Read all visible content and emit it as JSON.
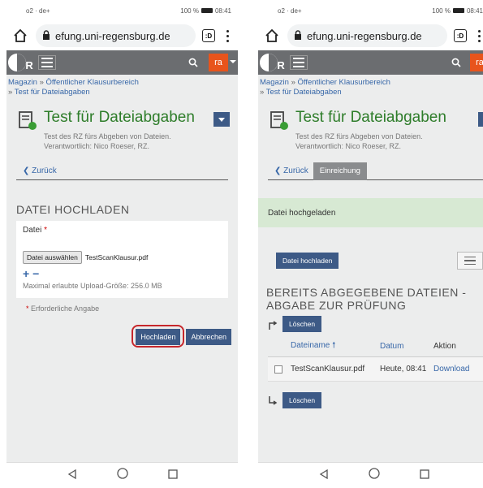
{
  "status_bar": {
    "left": "o2 · de+",
    "right_text": "100 %",
    "time": "08:41"
  },
  "browser": {
    "url": "efung.uni-regensburg.de",
    "tab_count": ":D"
  },
  "site_header": {
    "logo": "UR",
    "user_initials": "ra"
  },
  "breadcrumb": {
    "item1": "Magazin",
    "item2": "Öffentlicher Klausurbereich",
    "item3": "Test für Dateiabgaben",
    "separator": "»"
  },
  "page": {
    "title": "Test für Dateiabgaben",
    "subtitle1": "Test des RZ fürs Abgeben von Dateien.",
    "subtitle2": "Verantwortlich: Nico Roeser, RZ.",
    "back_label": "Zurück",
    "tab_submission": "Einreichung"
  },
  "left_screen": {
    "section_title": "DATEI HOCHLADEN",
    "file_label": "Datei",
    "required_mark": "*",
    "choose_button": "Datei auswählen",
    "chosen_file": "TestScanKlausur.pdf",
    "plus": "+",
    "minus": "−",
    "max_size": "Maximal erlaubte Upload-Größe: 256.0 MB",
    "required_note": "Erforderliche Angabe",
    "upload_button": "Hochladen",
    "cancel_button": "Abbrechen"
  },
  "right_screen": {
    "success_message": "Datei hochgeladen",
    "upload_file_button": "Datei hochladen",
    "submitted_title": "BEREITS ABGEGEBENE DATEIEN - ABGABE ZUR PRÜFUNG",
    "delete_button_top": "Löschen",
    "delete_button_bottom": "Löschen",
    "columns": {
      "filename": "Dateiname",
      "date": "Datum",
      "action": "Aktion"
    },
    "rows": [
      {
        "filename": "TestScanKlausur.pdf",
        "date": "Heute, 08:41",
        "action": "Download"
      }
    ]
  },
  "colors": {
    "header_gray": "#6b6d70",
    "title_green": "#2e7d2a",
    "button_blue": "#3d5a86",
    "user_orange": "#e8541c",
    "success_green": "#d7e9d3",
    "highlight_red": "#c6272c"
  }
}
